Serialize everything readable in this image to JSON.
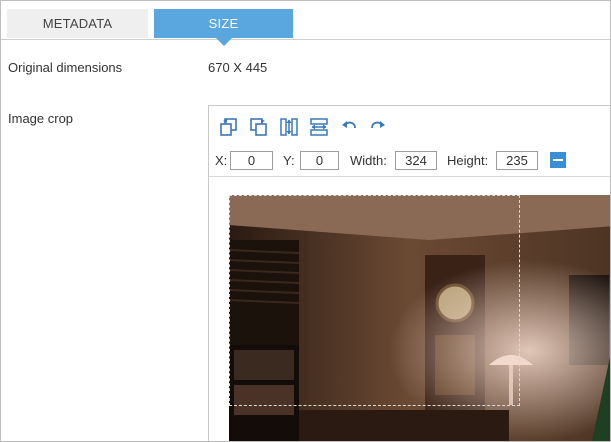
{
  "tabs": [
    {
      "label": "METADATA",
      "active": false
    },
    {
      "label": "SIZE",
      "active": true
    }
  ],
  "original_dimensions": {
    "label": "Original dimensions",
    "value": "670 X 445"
  },
  "image_crop": {
    "label": "Image crop"
  },
  "crop_toolbar": {
    "tools": [
      "crop-rotate-left-icon",
      "crop-rotate-right-icon",
      "flip-vertical-icon",
      "flip-horizontal-icon",
      "undo-icon",
      "redo-icon"
    ],
    "x_label": "X:",
    "x_value": "0",
    "y_label": "Y:",
    "y_value": "0",
    "width_label": "Width:",
    "width_value": "324",
    "height_label": "Height:",
    "height_value": "235"
  },
  "colors": {
    "accent": "#5aa7e0",
    "button_blue": "#3b8fd6"
  }
}
